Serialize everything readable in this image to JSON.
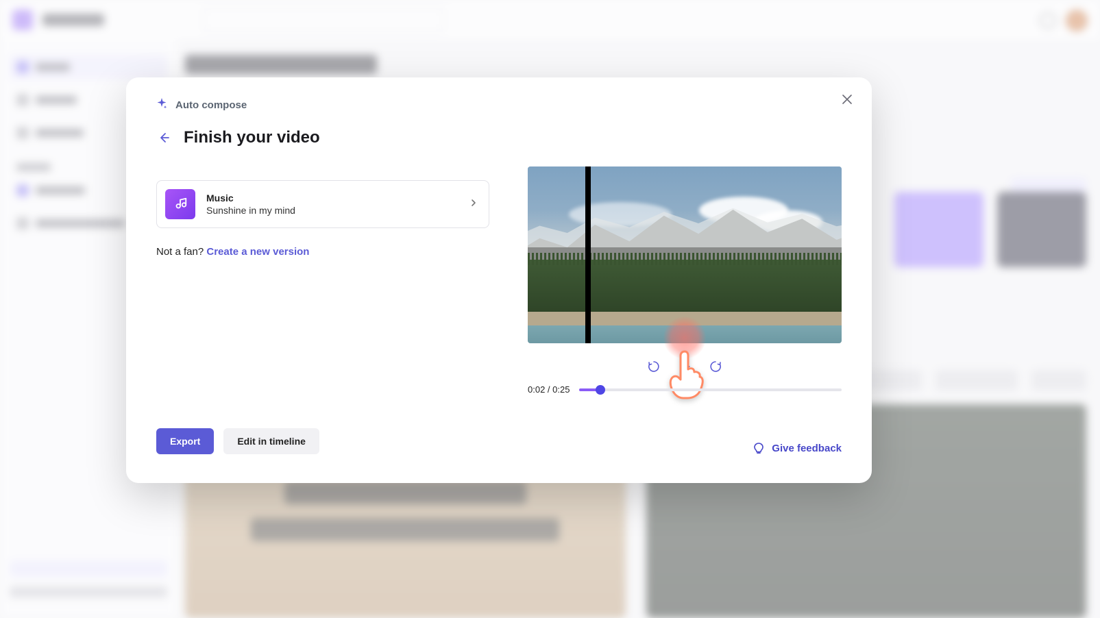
{
  "modal": {
    "pre_title": "Auto compose",
    "title": "Finish your video",
    "music": {
      "label": "Music",
      "track": "Sunshine in my mind"
    },
    "not_fan_text": "Not a fan? ",
    "create_new_link": "Create a new version",
    "export_label": "Export",
    "edit_timeline_label": "Edit in timeline",
    "feedback_label": "Give feedback"
  },
  "player": {
    "current_time": "0:02",
    "total_time": "0:25",
    "timecode_display": "0:02 / 0:25",
    "progress_percent": 8
  },
  "colors": {
    "accent": "#5b5bd6",
    "purple_gradient_a": "#a855f7",
    "purple_gradient_b": "#7c3aed"
  }
}
